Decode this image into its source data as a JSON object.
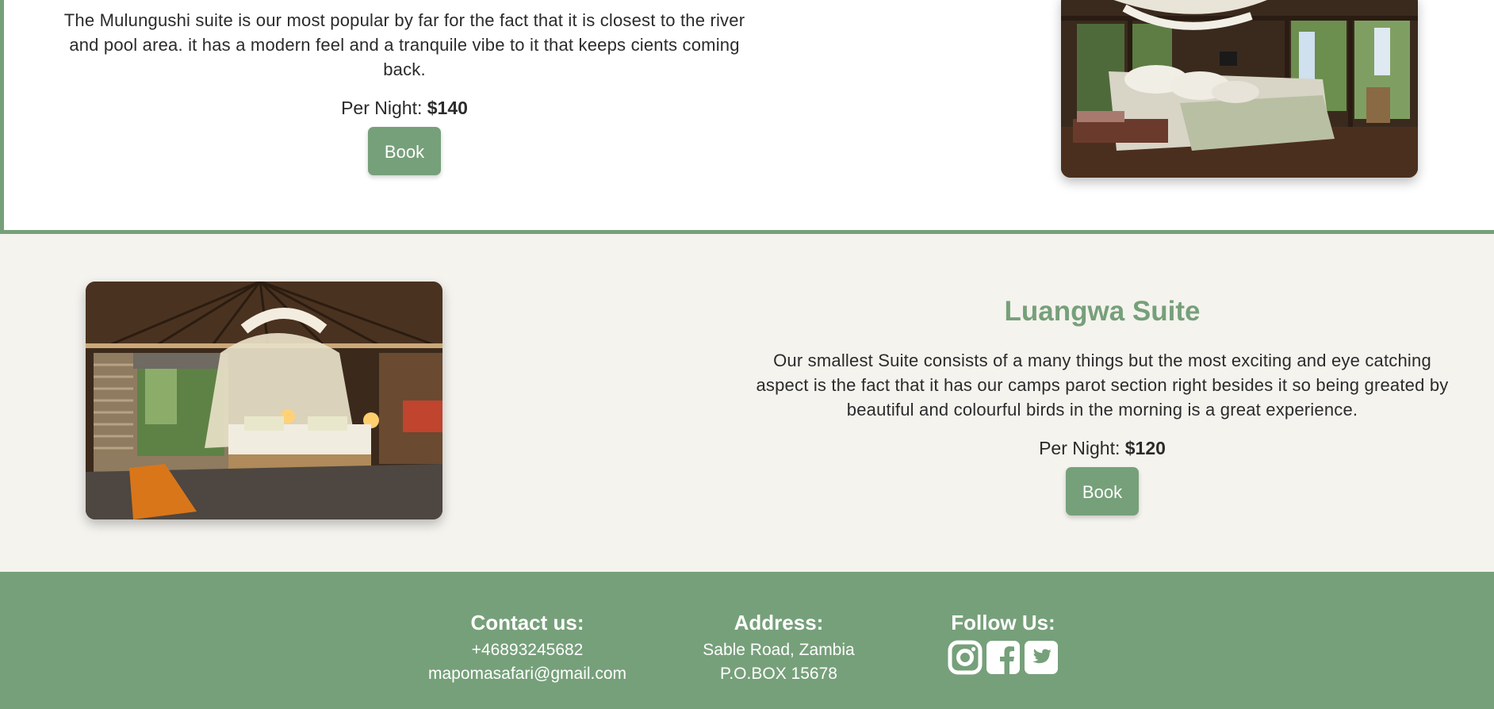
{
  "mulungushi": {
    "description": "The Mulungushi suite is our most popular by far for the fact that it is closest to the river and pool area. it has a modern feel and a tranquile vibe to it that keeps cients coming back.",
    "price_label": "Per Night: ",
    "price_value": "$140",
    "book_label": "Book"
  },
  "luangwa": {
    "title": "Luangwa Suite",
    "description": "Our smallest Suite consists of a many things but the most exciting and eye catching aspect is the fact that it has our camps parot section right besides it so being greated by beautiful and colourful birds in the morning is a great experience.",
    "price_label": "Per Night: ",
    "price_value": "$120",
    "book_label": "Book"
  },
  "footer": {
    "contact": {
      "heading": "Contact us:",
      "phone": "+46893245682",
      "email": "mapomasafari@gmail.com"
    },
    "address": {
      "heading": "Address:",
      "line1": "Sable Road, Zambia",
      "line2": "P.O.BOX 15678"
    },
    "follow": {
      "heading": "Follow Us:",
      "icons": [
        "instagram-icon",
        "facebook-icon",
        "twitter-icon"
      ]
    }
  },
  "colors": {
    "accent": "#76a07a",
    "section_bg": "#f5f3ee",
    "text": "#2b2b2b"
  }
}
